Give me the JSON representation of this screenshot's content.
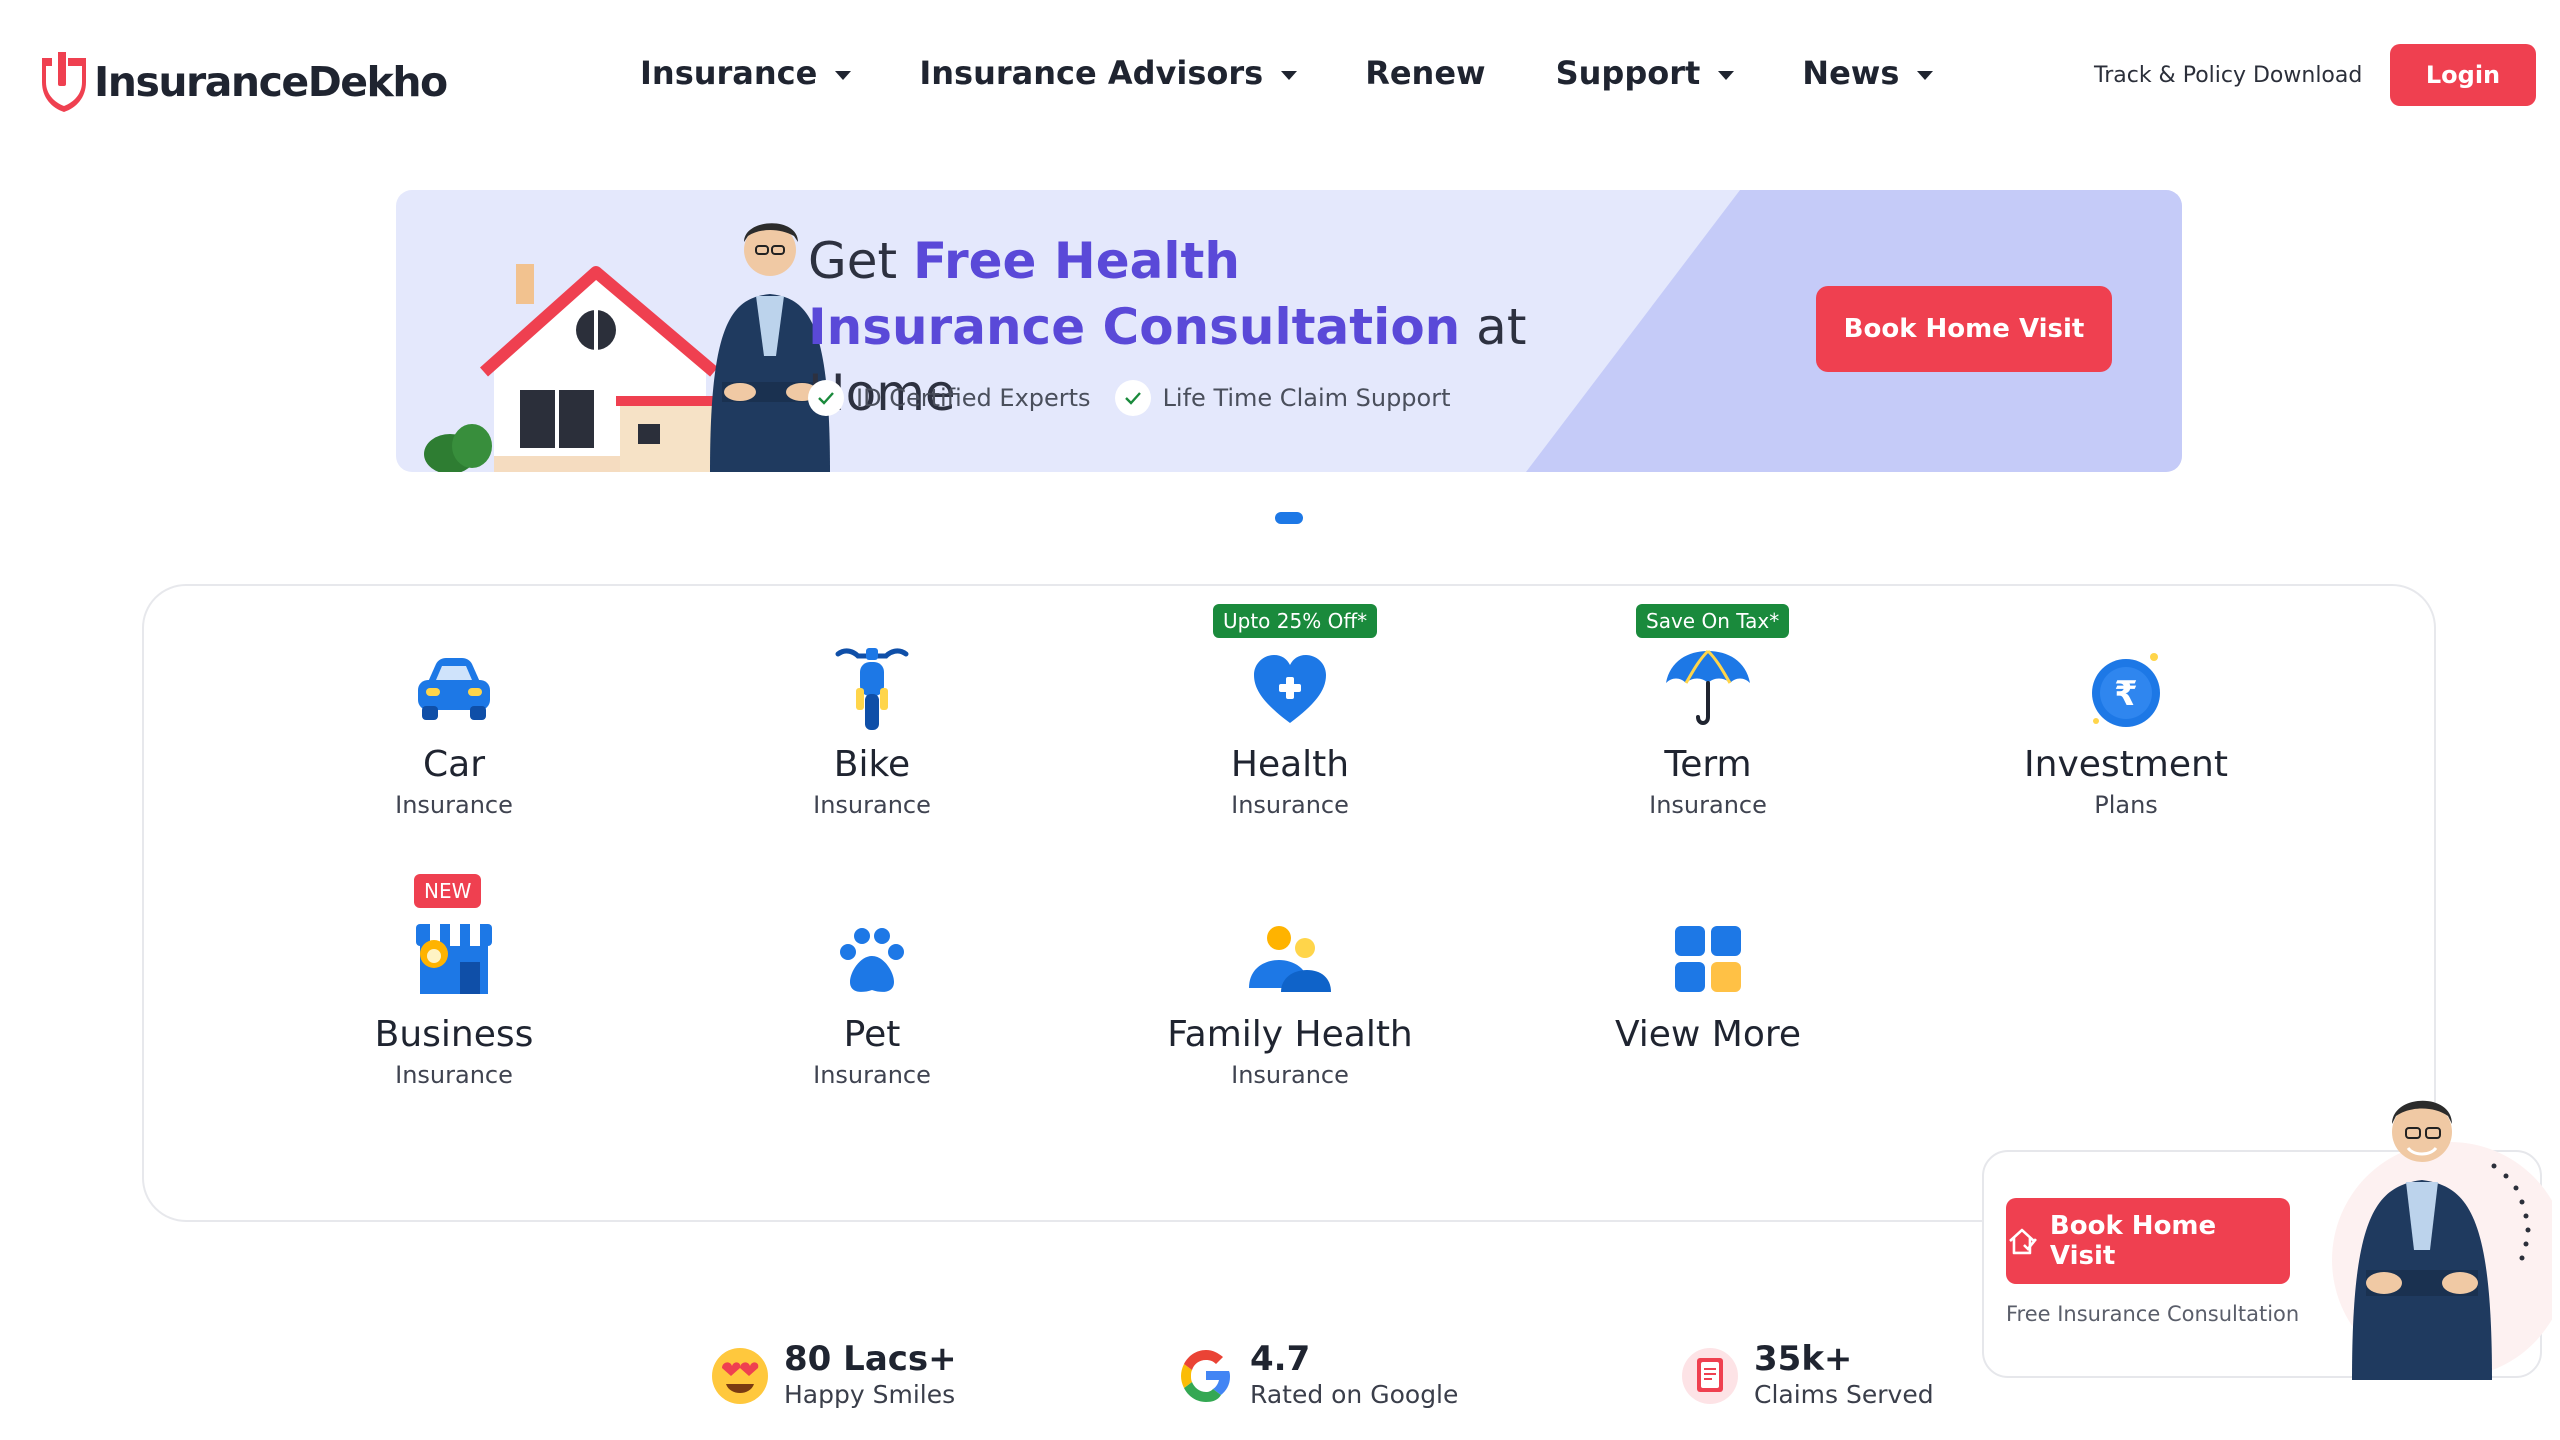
{
  "header": {
    "logo_text": "InsuranceDekho",
    "nav": [
      {
        "label": "Insurance",
        "has_dropdown": true
      },
      {
        "label": "Insurance Advisors",
        "has_dropdown": true
      },
      {
        "label": "Renew",
        "has_dropdown": false
      },
      {
        "label": "Support",
        "has_dropdown": true
      },
      {
        "label": "News",
        "has_dropdown": true
      }
    ],
    "track_link": "Track & Policy Download",
    "login_label": "Login"
  },
  "banner": {
    "title_prefix": "Get ",
    "title_highlight": "Free Health Insurance Consultation",
    "title_suffix": " at Home",
    "checks": [
      "ID Certified Experts",
      "Life Time Claim Support"
    ],
    "cta_label": "Book Home Visit",
    "slide_count": 1
  },
  "products": [
    {
      "name": "Car",
      "sub": "Insurance",
      "icon": "car-icon",
      "tag": ""
    },
    {
      "name": "Bike",
      "sub": "Insurance",
      "icon": "bike-icon",
      "tag": ""
    },
    {
      "name": "Health",
      "sub": "Insurance",
      "icon": "health-heart-icon",
      "tag": "Upto 25% Off*"
    },
    {
      "name": "Term",
      "sub": "Insurance",
      "icon": "umbrella-icon",
      "tag": "Save On Tax*"
    },
    {
      "name": "Investment",
      "sub": "Plans",
      "icon": "rupee-coin-icon",
      "tag": ""
    },
    {
      "name": "Business",
      "sub": "Insurance",
      "icon": "shop-icon",
      "tag": "NEW"
    },
    {
      "name": "Pet",
      "sub": "Insurance",
      "icon": "paw-icon",
      "tag": ""
    },
    {
      "name": "Family Health",
      "sub": "Insurance",
      "icon": "family-icon",
      "tag": ""
    },
    {
      "name": "View More",
      "sub": "",
      "icon": "grid-icon",
      "tag": ""
    }
  ],
  "stats": [
    {
      "value": "80 Lacs+",
      "label": "Happy Smiles",
      "icon": "smile-emoji-icon"
    },
    {
      "value": "4.7",
      "label": "Rated on Google",
      "icon": "google-icon"
    },
    {
      "value": "35k+",
      "label": "Claims Served",
      "icon": "claim-document-icon"
    }
  ],
  "float_widget": {
    "cta_label": "Book Home Visit",
    "subtext": "Free Insurance Consultation"
  },
  "colors": {
    "brand_red": "#ef4050",
    "accent_purple": "#5a49d8",
    "icon_blue": "#1d78e6",
    "tag_green": "#1a8a3c"
  }
}
